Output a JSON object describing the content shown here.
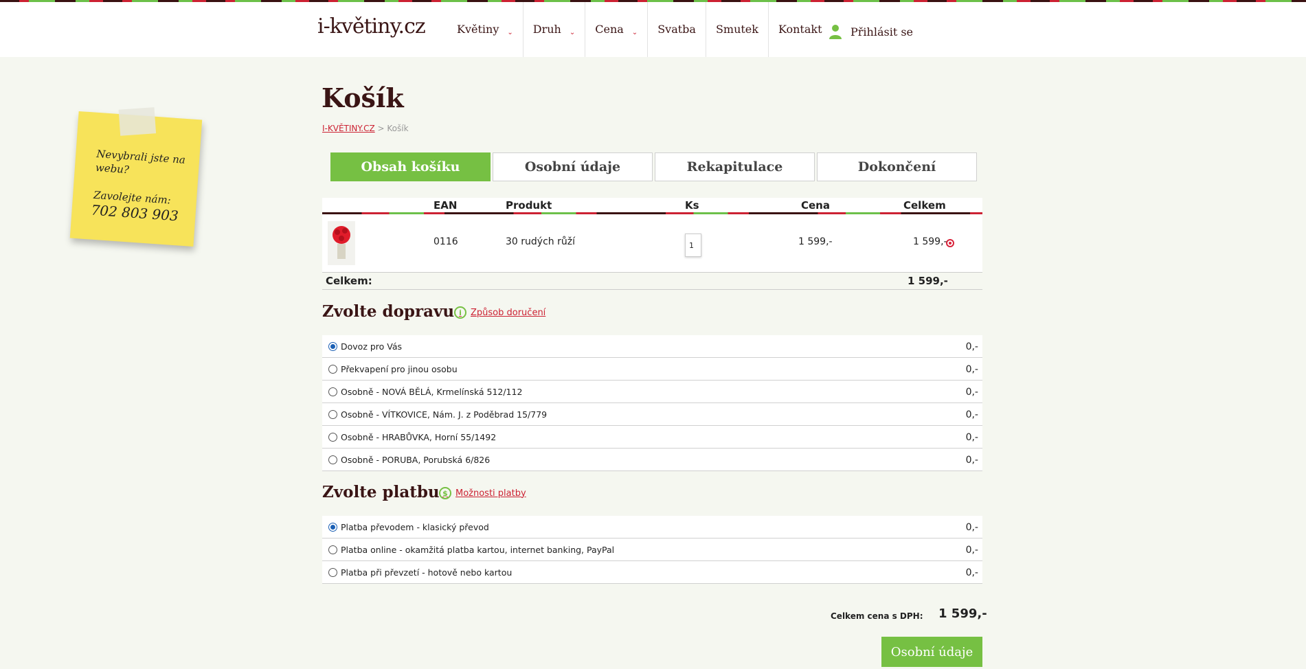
{
  "header": {
    "logo_text": "i-květiny.cz",
    "nav": [
      {
        "label": "Květiny",
        "dropdown": true
      },
      {
        "label": "Druh",
        "dropdown": true
      },
      {
        "label": "Cena",
        "dropdown": true
      },
      {
        "label": "Svatba",
        "dropdown": false
      },
      {
        "label": "Smutek",
        "dropdown": false
      },
      {
        "label": "Kontakt",
        "dropdown": false
      }
    ],
    "login_label": "Přihlásit se"
  },
  "sticky_note": {
    "line1": "Nevybrali jste na webu?",
    "line2": "Zavolejte nám:",
    "phone": "702 803 903"
  },
  "page": {
    "title": "Košík",
    "breadcrumb_home": "I-KVĚTINY.CZ",
    "breadcrumb_sep": " > ",
    "breadcrumb_current": "Košík"
  },
  "steps": [
    "Obsah košíku",
    "Osobní údaje",
    "Rekapitulace",
    "Dokončení"
  ],
  "cart": {
    "headers": {
      "ean": "EAN",
      "product": "Produkt",
      "qty": "Ks",
      "price": "Cena",
      "total": "Celkem"
    },
    "items": [
      {
        "ean": "0116",
        "product": "30 rudých růží",
        "qty": "1",
        "price": "1 599,-",
        "total": "1 599,-"
      }
    ],
    "total_label": "Celkem:",
    "total_value": "1 599,-"
  },
  "shipping": {
    "title": "Zvolte dopravu",
    "info_link": "Způsob doručení",
    "options": [
      {
        "label": "Dovoz pro Vás",
        "price": "0,-",
        "selected": true
      },
      {
        "label": "Překvapení pro jinou osobu",
        "price": "0,-",
        "selected": false
      },
      {
        "label": "Osobně - NOVÁ BĚLÁ, Krmelínská 512/112",
        "price": "0,-",
        "selected": false
      },
      {
        "label": "Osobně - VÍTKOVICE, Nám. J. z Poděbrad 15/779",
        "price": "0,-",
        "selected": false
      },
      {
        "label": "Osobně - HRABŮVKA, Horní 55/1492",
        "price": "0,-",
        "selected": false
      },
      {
        "label": "Osobně - PORUBA, Porubská 6/826",
        "price": "0,-",
        "selected": false
      }
    ]
  },
  "payment": {
    "title": "Zvolte platbu",
    "info_link": "Možnosti platby",
    "options": [
      {
        "label": "Platba převodem - klasický převod",
        "price": "0,-",
        "selected": true
      },
      {
        "label": "Platba online - okamžitá platba kartou, internet banking, PayPal",
        "price": "0,-",
        "selected": false
      },
      {
        "label": "Platba při převzetí - hotově nebo kartou",
        "price": "0,-",
        "selected": false
      }
    ]
  },
  "summary": {
    "label": "Celkem cena s DPH:",
    "value": "1 599,-",
    "next_button": "Osobní údaje"
  },
  "colors": {
    "accent_green": "#76c043",
    "accent_red": "#cc2233",
    "brand_dark": "#3a1515",
    "radio_blue": "#1a5fb4"
  }
}
